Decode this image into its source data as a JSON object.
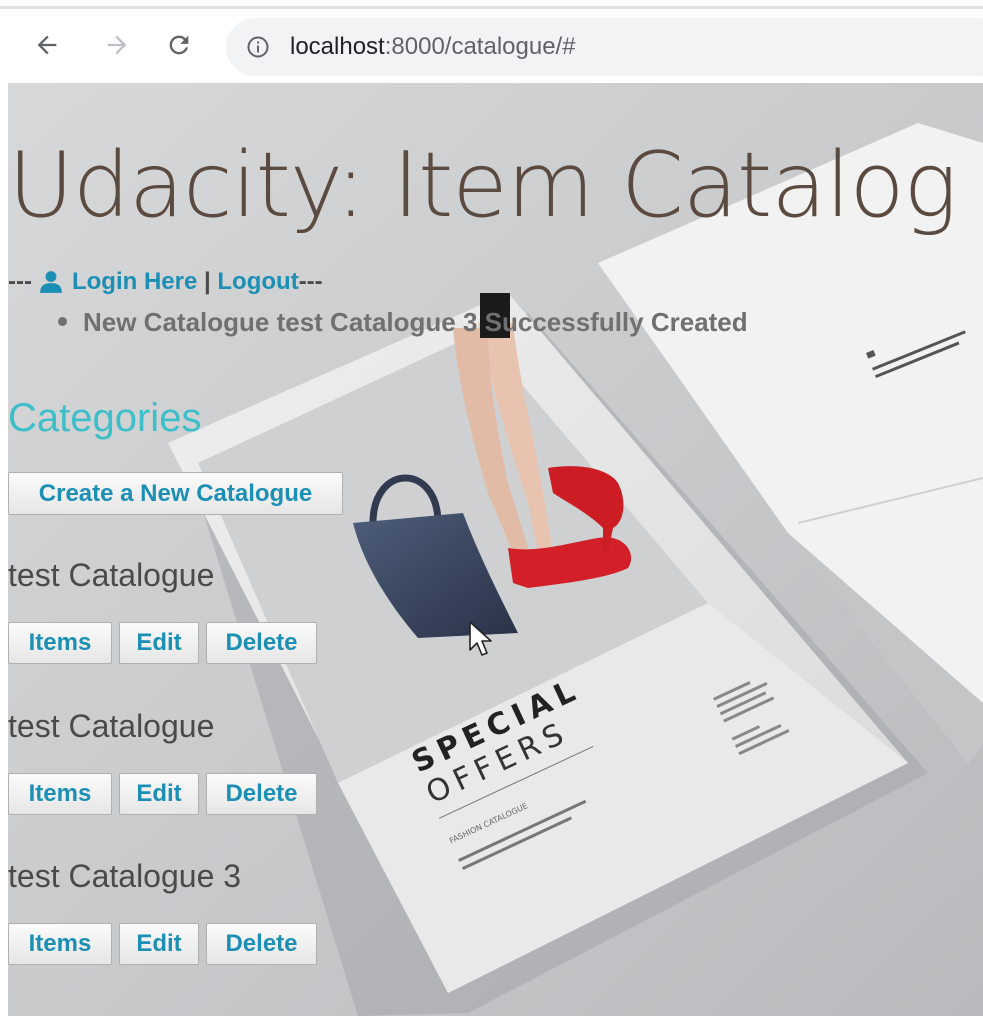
{
  "browser": {
    "url_host": "localhost",
    "url_path": ":8000/catalogue/#"
  },
  "page": {
    "title": "Udacity: Item Catalog",
    "auth": {
      "prefix": "---",
      "login_label": "Login Here",
      "separator": " | ",
      "logout_label": "Logout",
      "suffix": "---"
    },
    "flash_message": "New Catalogue test Catalogue 3 Successfully Created",
    "categories_heading": "Categories",
    "create_button_label": "Create a New Catalogue",
    "catalogues": [
      {
        "name": "test Catalogue",
        "items_label": "Items",
        "edit_label": "Edit",
        "delete_label": "Delete"
      },
      {
        "name": "test Catalogue",
        "items_label": "Items",
        "edit_label": "Edit",
        "delete_label": "Delete"
      },
      {
        "name": "test Catalogue 3",
        "items_label": "Items",
        "edit_label": "Edit",
        "delete_label": "Delete"
      }
    ],
    "background_image": {
      "text_line_1": "SPECIAL",
      "text_line_2": "OFFERS",
      "text_line_3": "FASHION CATALOGUE"
    }
  },
  "colors": {
    "link": "#1c8fb5",
    "heading_accent": "#3dbfca",
    "title": "#5a4a40"
  }
}
